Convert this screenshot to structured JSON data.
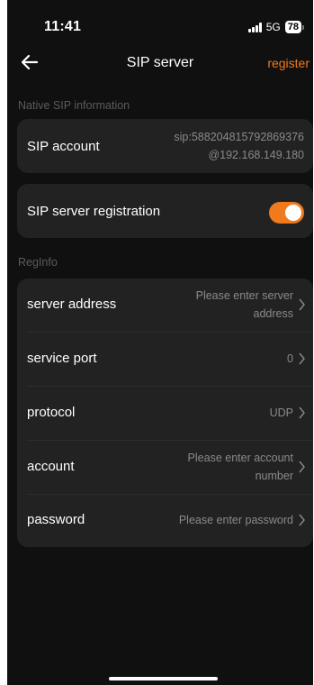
{
  "status_bar": {
    "time": "11:41",
    "network": "5G",
    "battery": "78"
  },
  "nav": {
    "title": "SIP server",
    "register_label": "register",
    "accent_color": "#f07a1c"
  },
  "native_section": {
    "label": "Native SIP information",
    "sip_account_label": "SIP account",
    "sip_account_value_line1": "sip:588204815792869376",
    "sip_account_value_line2": "@192.168.149.180"
  },
  "registration": {
    "label": "SIP server registration",
    "enabled": true
  },
  "reginfo_section": {
    "label": "RegInfo",
    "rows": [
      {
        "label": "server address",
        "value_line1": "Please enter server",
        "value_line2": "address"
      },
      {
        "label": "service port",
        "value_line1": "0"
      },
      {
        "label": "protocol",
        "value_line1": "UDP"
      },
      {
        "label": "account",
        "value_line1": "Please enter account",
        "value_line2": "number"
      },
      {
        "label": "password",
        "value_line1": "Please enter password"
      }
    ]
  },
  "icons": {
    "back": "arrow-left-icon",
    "chevron": "chevron-right-icon"
  }
}
